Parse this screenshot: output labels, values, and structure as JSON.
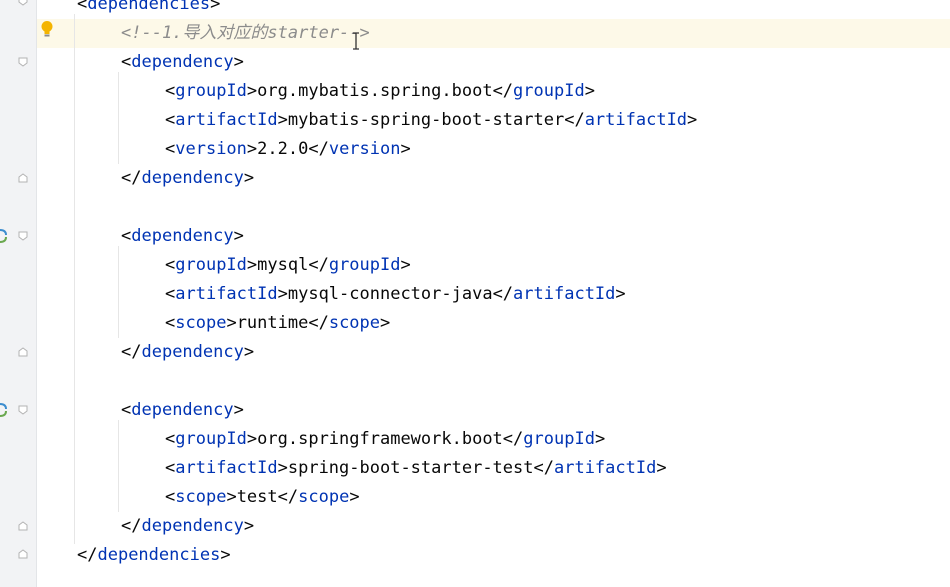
{
  "editor": {
    "lines": [
      {
        "indent": 0,
        "type": "open",
        "tag": "dependencies"
      },
      {
        "indent": 1,
        "type": "comment",
        "text": "<!--1.导入对应的starter-->"
      },
      {
        "indent": 1,
        "type": "open",
        "tag": "dependency"
      },
      {
        "indent": 2,
        "type": "elem",
        "tag": "groupId",
        "value": "org.mybatis.spring.boot"
      },
      {
        "indent": 2,
        "type": "elem",
        "tag": "artifactId",
        "value": "mybatis-spring-boot-starter"
      },
      {
        "indent": 2,
        "type": "elem",
        "tag": "version",
        "value": "2.2.0"
      },
      {
        "indent": 1,
        "type": "close",
        "tag": "dependency"
      },
      {
        "indent": 0,
        "type": "blank"
      },
      {
        "indent": 1,
        "type": "open",
        "tag": "dependency"
      },
      {
        "indent": 2,
        "type": "elem",
        "tag": "groupId",
        "value": "mysql"
      },
      {
        "indent": 2,
        "type": "elem",
        "tag": "artifactId",
        "value": "mysql-connector-java"
      },
      {
        "indent": 2,
        "type": "elem",
        "tag": "scope",
        "value": "runtime"
      },
      {
        "indent": 1,
        "type": "close",
        "tag": "dependency"
      },
      {
        "indent": 0,
        "type": "blank"
      },
      {
        "indent": 1,
        "type": "open",
        "tag": "dependency"
      },
      {
        "indent": 2,
        "type": "elem",
        "tag": "groupId",
        "value": "org.springframework.boot"
      },
      {
        "indent": 2,
        "type": "elem",
        "tag": "artifactId",
        "value": "spring-boot-starter-test"
      },
      {
        "indent": 2,
        "type": "elem",
        "tag": "scope",
        "value": "test"
      },
      {
        "indent": 1,
        "type": "close",
        "tag": "dependency"
      },
      {
        "indent": 0,
        "type": "close",
        "tag": "dependencies"
      }
    ],
    "highlighted_line": 1
  },
  "colors": {
    "tag": "#0033b3",
    "text": "#080808",
    "comment": "#8c8c8c",
    "highlight": "#fdf9e8",
    "gutter": "#f2f3f5"
  },
  "icons": {
    "intention": "lightbulb-icon",
    "run": "run-gutter-icon",
    "fold": "fold-marker-icon",
    "cursor": "text-cursor-icon"
  }
}
